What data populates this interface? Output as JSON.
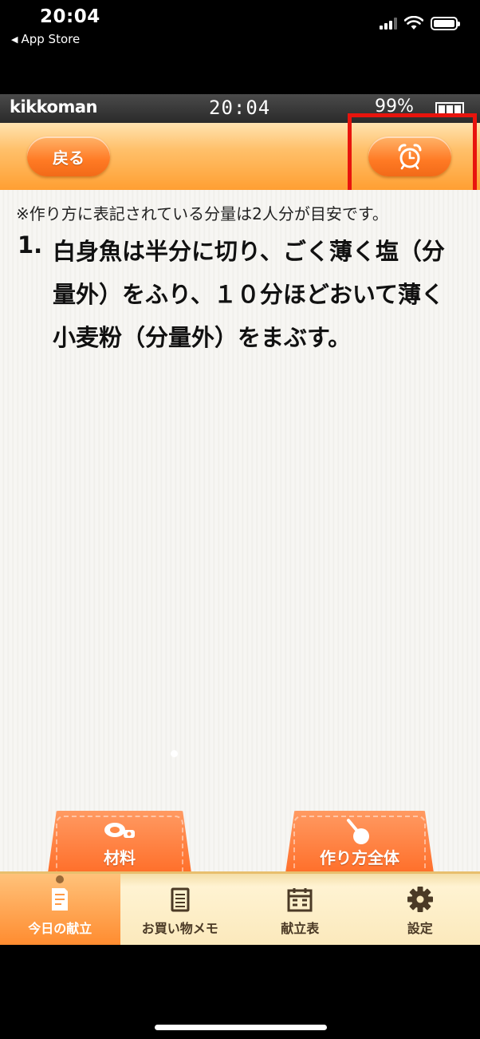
{
  "ios_status": {
    "time": "20:04",
    "back_label": "App Store"
  },
  "app_status": {
    "brand": "kikkoman",
    "time": "20:04",
    "battery": "99%"
  },
  "header": {
    "back_label": "戻る",
    "alarm_icon": "alarm-clock-icon"
  },
  "content": {
    "note": "※作り方に表記されている分量は2人分が目安です。",
    "step_number": "1.",
    "step_text": "白身魚は半分に切り、ごく薄く塩（分量外）をふり、１０分ほどおいて薄く小麦粉（分量外）をまぶす。"
  },
  "folder_tabs": [
    {
      "label": "材料",
      "icon": "meat-icon"
    },
    {
      "label": "作り方全体",
      "icon": "frying-pan-icon"
    }
  ],
  "tabbar": {
    "items": [
      {
        "label": "今日の献立",
        "icon": "notebook-icon",
        "active": true
      },
      {
        "label": "お買い物メモ",
        "icon": "memo-pad-icon",
        "active": false
      },
      {
        "label": "献立表",
        "icon": "calendar-icon",
        "active": false
      },
      {
        "label": "設定",
        "icon": "gear-icon",
        "active": false
      }
    ]
  },
  "colors": {
    "accent_orange": "#ff7a24",
    "highlight_red": "#e8140d",
    "tabbar_bg": "#fbe9bc"
  }
}
